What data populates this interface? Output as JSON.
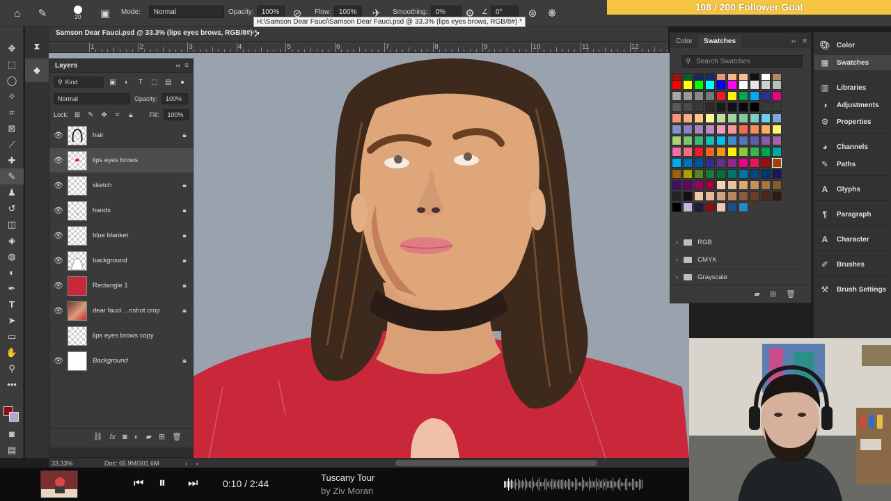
{
  "goal": {
    "text": "108 / 200 Follower Goal"
  },
  "options_bar": {
    "brush_size": "20",
    "mode_label": "Mode:",
    "mode_value": "Normal",
    "opacity_label": "Opacity:",
    "opacity_value": "100%",
    "flow_label": "Flow:",
    "flow_value": "100%",
    "smoothing_label": "Smoothing:",
    "smoothing_value": "0%",
    "angle_value": "0°"
  },
  "document": {
    "tab_title": "Samson Dear Fauci.psd @ 33.3% (lips eyes brows, RGB/8#) *",
    "tooltip": "H:\\Samson Dear Fauci\\Samson Dear Fauci.psd @ 33.3% (lips eyes brows, RGB/8#) *",
    "ruler_numbers": [
      "1",
      "2",
      "3",
      "4",
      "5",
      "6",
      "7",
      "8",
      "9",
      "10",
      "11",
      "12"
    ]
  },
  "layers_panel": {
    "title": "Layers",
    "filter_kind": "Kind",
    "blend_mode": "Normal",
    "opacity_label": "Opacity:",
    "opacity_value": "100%",
    "lock_label": "Lock:",
    "fill_label": "Fill:",
    "fill_value": "100%",
    "layers": [
      {
        "name": "hair",
        "visible": true,
        "locked": true,
        "selected": false
      },
      {
        "name": "lips eyes brows",
        "visible": true,
        "locked": false,
        "selected": true
      },
      {
        "name": "sketch",
        "visible": true,
        "locked": true,
        "selected": false
      },
      {
        "name": "hands",
        "visible": true,
        "locked": true,
        "selected": false
      },
      {
        "name": "blue blanket",
        "visible": true,
        "locked": true,
        "selected": false
      },
      {
        "name": "background",
        "visible": true,
        "locked": true,
        "selected": false
      },
      {
        "name": "Rectangle 1",
        "visible": true,
        "locked": true,
        "selected": false
      },
      {
        "name": "dear fauci ...nshot crop",
        "visible": true,
        "locked": true,
        "selected": false
      },
      {
        "name": "lips eyes brows copy",
        "visible": false,
        "locked": false,
        "selected": false
      },
      {
        "name": "Background",
        "visible": true,
        "locked": true,
        "selected": false
      }
    ]
  },
  "status_bar": {
    "zoom": "33.33%",
    "doc_info": "Doc: 65.9M/301.6M",
    "scroll_start": "0"
  },
  "swatches_panel": {
    "tabs": [
      "Color",
      "Swatches"
    ],
    "active_tab": "Swatches",
    "search_placeholder": "Search Swatches",
    "groups": [
      "RGB",
      "CMYK",
      "Grayscale"
    ]
  },
  "right_panels": {
    "items": [
      "Color",
      "Swatches",
      "Libraries",
      "Adjustments",
      "Properties",
      "Channels",
      "Paths",
      "Glyphs",
      "Paragraph",
      "Character",
      "Brushes",
      "Brush Settings"
    ],
    "active": "Swatches"
  },
  "player": {
    "time": "0:10 / 2:44",
    "track": "Tuscany Tour",
    "artist": "by Ziv Moran"
  },
  "colors": {
    "fg_color": "#8b0f12",
    "bg_color": "#b9a0d6",
    "canvas_bg": "#9aa2ad",
    "shirt": "#c9283a",
    "goal_bar": "#f6c542"
  }
}
